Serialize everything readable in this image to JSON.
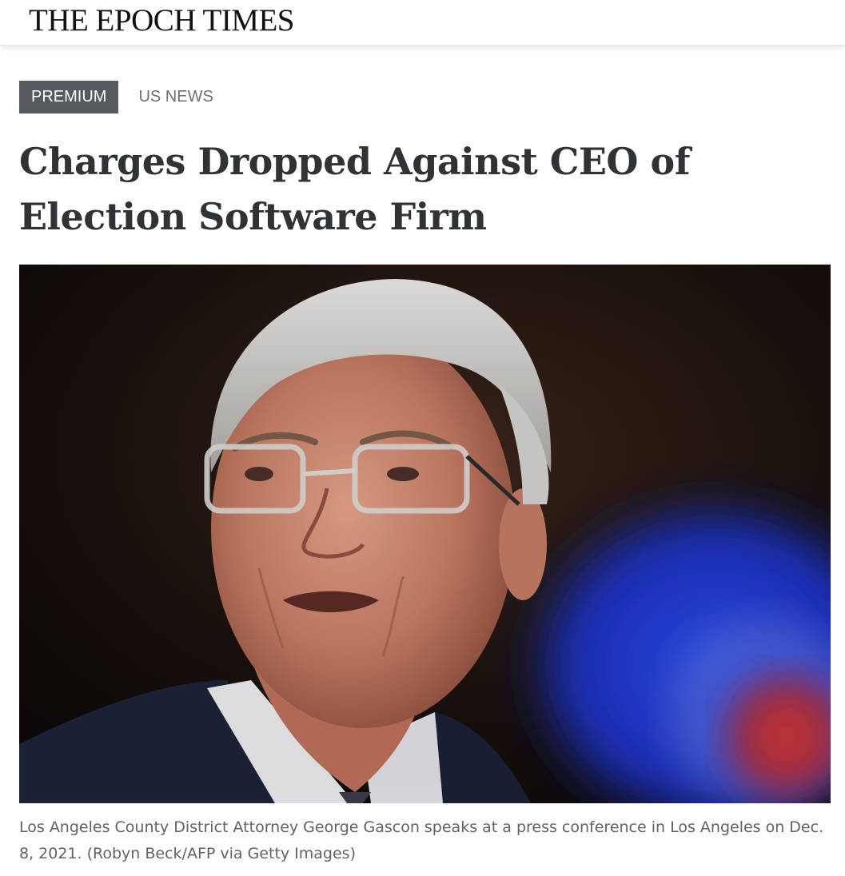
{
  "site": {
    "logo": "THE EPOCH TIMES"
  },
  "article": {
    "premium_label": "PREMIUM",
    "category": "US NEWS",
    "headline": "Charges Dropped Against CEO of Election Software Firm",
    "image_alt": "Los Angeles County District Attorney George Gascon speaking at a press conference",
    "caption": "Los Angeles County District Attorney George Gascon speaks at a press conference in Los Angeles on Dec. 8, 2021. (Robyn Beck/AFP via Getty Images)"
  },
  "colors": {
    "premium_badge": "#555a5e",
    "headline": "#2f3336",
    "caption": "#5f6368"
  }
}
